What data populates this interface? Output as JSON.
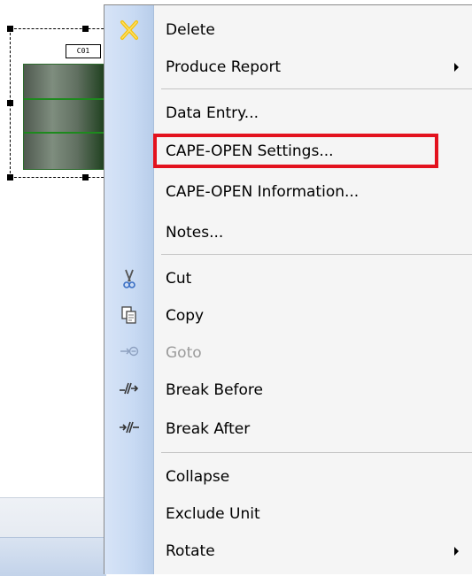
{
  "flowsheet": {
    "unit_tag": "C01"
  },
  "menu": {
    "items": [
      {
        "label": "Delete",
        "icon": "delete-x-icon",
        "disabled": false,
        "submenu": false
      },
      {
        "label": "Produce Report",
        "icon": "",
        "disabled": false,
        "submenu": true
      },
      {
        "label": "Data Entry...",
        "icon": "",
        "disabled": false,
        "submenu": false
      },
      {
        "label": "CAPE-OPEN Settings...",
        "icon": "",
        "disabled": false,
        "submenu": false,
        "highlighted": true
      },
      {
        "label": "CAPE-OPEN Information...",
        "icon": "",
        "disabled": false,
        "submenu": false
      },
      {
        "label": "Notes...",
        "icon": "",
        "disabled": false,
        "submenu": false
      },
      {
        "label": "Cut",
        "icon": "scissors-icon",
        "disabled": false,
        "submenu": false
      },
      {
        "label": "Copy",
        "icon": "copy-icon",
        "disabled": false,
        "submenu": false
      },
      {
        "label": "Goto",
        "icon": "goto-icon",
        "disabled": true,
        "submenu": false
      },
      {
        "label": "Break Before",
        "icon": "break-before-icon",
        "disabled": false,
        "submenu": false
      },
      {
        "label": "Break After",
        "icon": "break-after-icon",
        "disabled": false,
        "submenu": false
      },
      {
        "label": "Collapse",
        "icon": "",
        "disabled": false,
        "submenu": false
      },
      {
        "label": "Exclude Unit",
        "icon": "",
        "disabled": false,
        "submenu": false
      },
      {
        "label": "Rotate",
        "icon": "",
        "disabled": false,
        "submenu": true
      }
    ]
  },
  "colors": {
    "highlight_box": "#e3121e",
    "menu_gutter": "#c8daf3",
    "disabled_text": "#9b9b9b",
    "unit_tray": "#1d8a1d"
  }
}
